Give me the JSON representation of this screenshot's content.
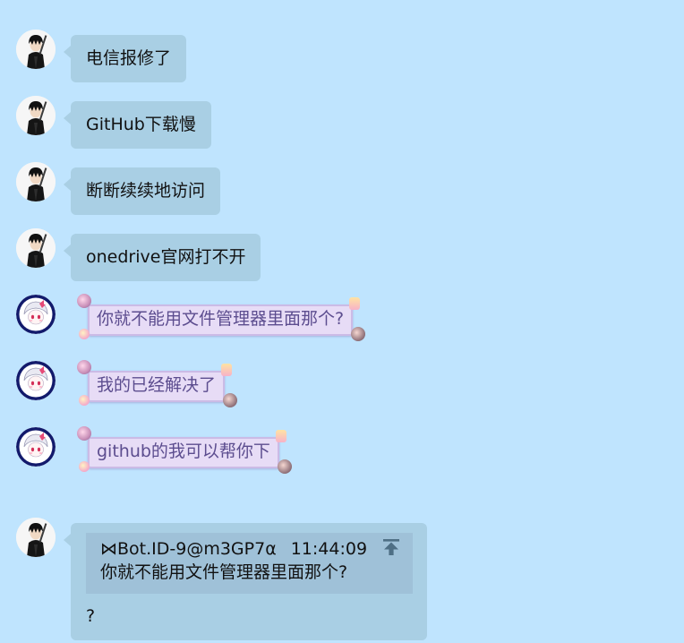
{
  "chat": {
    "messages": [
      {
        "text": "电信报修了"
      },
      {
        "text": "GitHub下载慢"
      },
      {
        "text": "断断续续地访问"
      },
      {
        "text": "onedrive官网打不开"
      },
      {
        "text": "你就不能用文件管理器里面那个?"
      },
      {
        "text": "我的已经解决了"
      },
      {
        "text": "github的我可以帮你下"
      }
    ],
    "reply": {
      "quote": {
        "sender": "⋈Bot.ID-9@m3GP7α",
        "time": "11:44:09",
        "text": "你就不能用文件管理器里面那个?"
      },
      "text": "?"
    }
  },
  "icons": {
    "avatar_a": "dark-haired-character-avatar",
    "avatar_b": "white-haired-anime-girl-avatar",
    "jump": "jump-to-original-arrow-icon"
  },
  "colors": {
    "background": "#bfe4fe",
    "bubble": "#a9cfe4",
    "quote_box": "#9fc1d8",
    "fancy_bubble_bg": "#e7dcf6",
    "fancy_bubble_text": "#5c4d8f",
    "avatar_ring": "#121a6c"
  }
}
